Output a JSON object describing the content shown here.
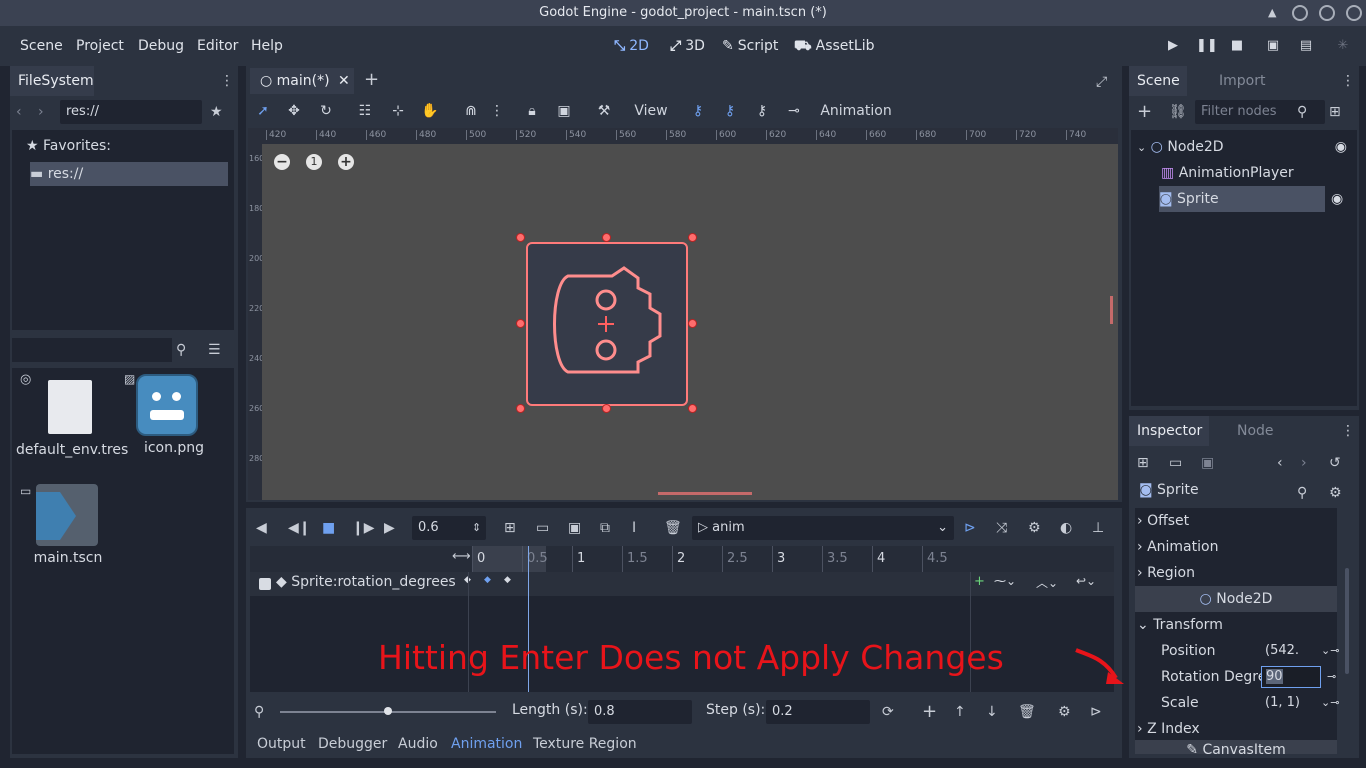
{
  "window": {
    "title": "Godot Engine - godot_project - main.tscn (*)"
  },
  "menu": [
    "Scene",
    "Project",
    "Debug",
    "Editor",
    "Help"
  ],
  "workspaces": [
    {
      "icon": "2d-icon",
      "glyph": "⤡",
      "label": "2D"
    },
    {
      "icon": "3d-icon",
      "glyph": "⤢",
      "label": "3D"
    },
    {
      "icon": "script-icon",
      "glyph": "✎",
      "label": "Script"
    },
    {
      "icon": "assetlib-icon",
      "glyph": "⛟",
      "label": "AssetLib"
    }
  ],
  "filesystem": {
    "tab": "FileSystem",
    "path": "res://",
    "favorites_label": "Favorites:",
    "tree_root": "res://",
    "files": [
      {
        "name": "default_env.tres"
      },
      {
        "name": "icon.png"
      },
      {
        "name": "main.tscn"
      }
    ]
  },
  "editor": {
    "scene_tab": "main(*)",
    "view_label": "View",
    "animation_label": "Animation",
    "ruler_x": [
      "420",
      "440",
      "460",
      "480",
      "500",
      "520",
      "540",
      "560",
      "580",
      "600",
      "620",
      "640",
      "660",
      "680",
      "700",
      "720",
      "740"
    ],
    "ruler_y": [
      "160",
      "180",
      "200",
      "220",
      "240",
      "260",
      "280"
    ],
    "zoom_reset": "1"
  },
  "animation": {
    "time": "0.6",
    "anim_name": "anim",
    "timeline_marks": [
      "0",
      "0.5",
      "1",
      "1.5",
      "2",
      "2.5",
      "3",
      "3.5",
      "4",
      "4.5"
    ],
    "track_name": "Sprite:rotation_degrees",
    "length_label": "Length (s):",
    "length": "0.8",
    "step_label": "Step (s):",
    "step": "0.2"
  },
  "annotation": {
    "text": "Hitting Enter Does not Apply Changes",
    "color": "#e8141a"
  },
  "scene_dock": {
    "tabs": [
      "Scene",
      "Import"
    ],
    "filter_placeholder": "Filter nodes",
    "nodes": [
      {
        "name": "Node2D"
      },
      {
        "name": "AnimationPlayer"
      },
      {
        "name": "Sprite"
      }
    ]
  },
  "inspector": {
    "tabs": [
      "Inspector",
      "Node"
    ],
    "object": "Sprite",
    "sections": [
      "Offset",
      "Animation",
      "Region"
    ],
    "group": "Node2D",
    "transform": "Transform",
    "position_label": "Position",
    "position_value": "(542.",
    "rotation_label": "Rotation Degre",
    "rotation_value": "90",
    "scale_label": "Scale",
    "scale_value": "(1, 1)",
    "z_index": "Z Index",
    "canvas_item": "CanvasItem"
  },
  "bottom_tabs": [
    "Output",
    "Debugger",
    "Audio",
    "Animation",
    "Texture Region"
  ],
  "colors": {
    "accent": "#6fa0ef",
    "selection": "#e8141a"
  }
}
